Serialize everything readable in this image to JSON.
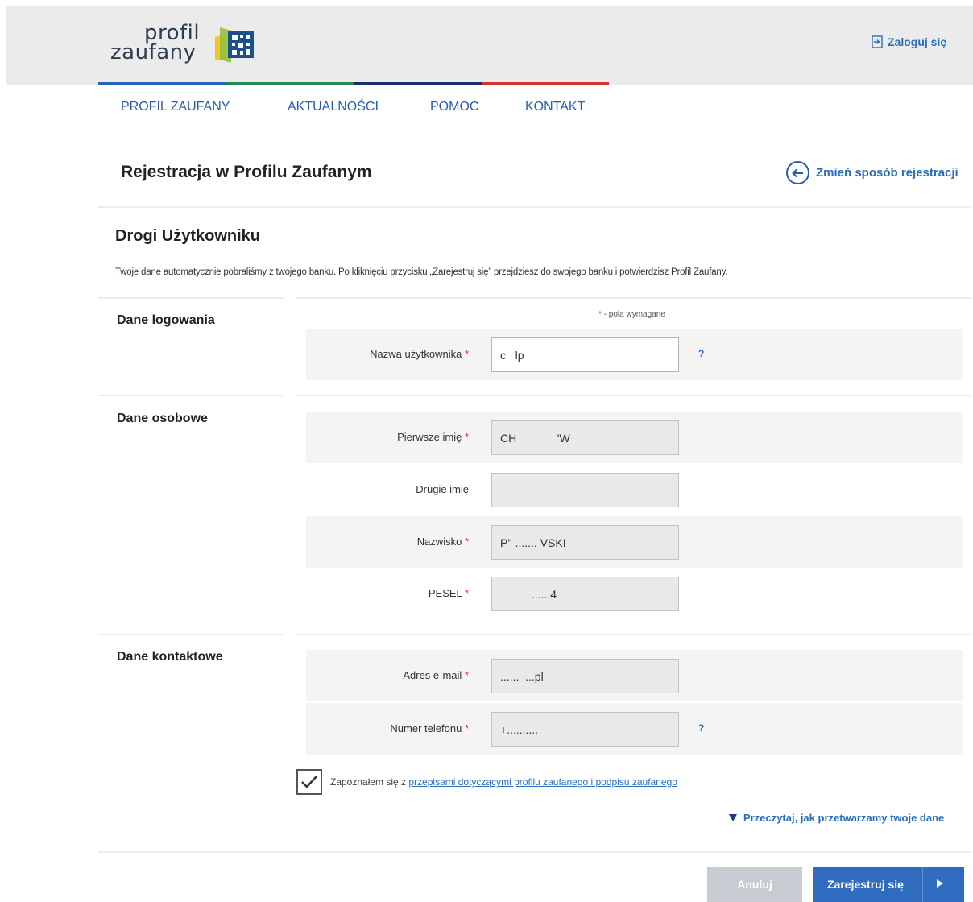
{
  "header": {
    "logo_line1": "profil",
    "logo_line2": "zaufany",
    "login_label": "Zaloguj się"
  },
  "nav": {
    "items": [
      {
        "label": "PROFIL ZAUFANY"
      },
      {
        "label": "AKTUALNOŚCI"
      },
      {
        "label": "POMOC"
      },
      {
        "label": "KONTAKT"
      }
    ],
    "bar_colors": [
      "#2a63b8",
      "#1f8a4c",
      "#1a2f6e",
      "#d63031"
    ]
  },
  "page": {
    "title": "Rejestracja w Profilu Zaufanym",
    "change_method_label": "Zmień sposób rejestracji",
    "greeting": "Drogi Użytkowniku",
    "intro": "Twoje dane automatycznie pobraliśmy z twojego banku. Po kliknięciu przycisku „Zarejestruj się” przejdziesz do swojego banku i potwierdzisz Profil Zaufany.",
    "required_note": "- pola wymagane"
  },
  "sections": {
    "login": {
      "label": "Dane logowania",
      "username": {
        "label": "Nazwa użytkownika",
        "value": "c   lp",
        "help": "?"
      }
    },
    "personal": {
      "label": "Dane osobowe",
      "first_name": {
        "label": "Pierwsze imię",
        "value": "CH             'W"
      },
      "second_name": {
        "label": "Drugie imię",
        "value": ""
      },
      "surname": {
        "label": "Nazwisko",
        "value": "P'' ....... VSKI"
      },
      "pesel": {
        "label": "PESEL",
        "value": "          ......4"
      }
    },
    "contact": {
      "label": "Dane kontaktowe",
      "email": {
        "label": "Adres e-mail",
        "value": "......  ...pl"
      },
      "phone": {
        "label": "Numer telefonu",
        "value": "+..........",
        "help": "?"
      }
    }
  },
  "consent": {
    "prefix": "Zapoznałem się z ",
    "link": "przepisami dotyczącymi profilu zaufanego i podpisu zaufanego",
    "checked": true
  },
  "privacy_link": "Przeczytaj, jak przetwarzamy twoje dane",
  "buttons": {
    "cancel": "Anuluj",
    "register": "Zarejestruj się"
  }
}
